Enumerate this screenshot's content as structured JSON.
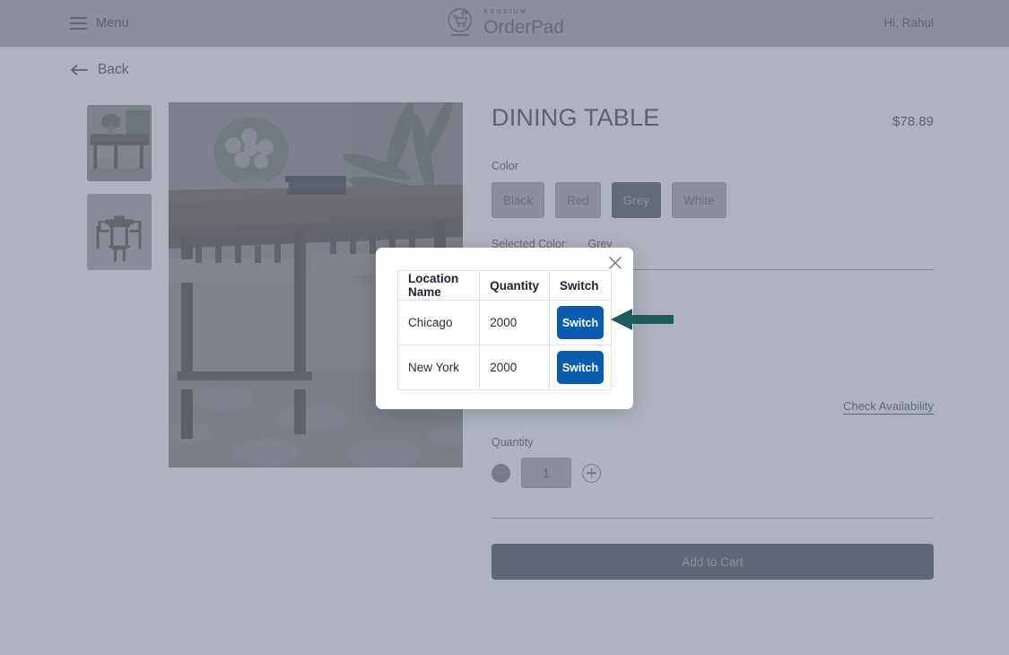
{
  "header": {
    "menu_label": "Menu",
    "brand_kicker": "KENSIUM",
    "brand_name": "OrderPad",
    "greeting": "Hi, Rahul"
  },
  "nav": {
    "back_label": "Back"
  },
  "gallery": {
    "thumbnails": [
      {
        "alt": "dining-table-with-vase",
        "selected": true
      },
      {
        "alt": "dining-table-with-chairs",
        "selected": false
      }
    ],
    "main_image_alt": "dining-table-with-vase-and-books"
  },
  "product": {
    "title": "DINING TABLE",
    "price": "$78.89",
    "color_label": "Color",
    "color_options": [
      "Black",
      "Red",
      "Grey",
      "White"
    ],
    "selected_color_index": 2,
    "selected_color_label": "Selected Color:",
    "selected_color_value": "Grey",
    "check_availability_label": "Check Availability",
    "quantity_label": "Quantity",
    "quantity_value": "1",
    "add_to_cart_label": "Add to Cart"
  },
  "modal": {
    "close_label": "×",
    "columns": [
      "Location Name",
      "Quantity",
      "Switch"
    ],
    "rows": [
      {
        "location": "Chicago",
        "quantity": "2000",
        "action": "Switch"
      },
      {
        "location": "New York",
        "quantity": "2000",
        "action": "Switch"
      }
    ]
  },
  "annotation": {
    "arrow_color": "#1f5b5e",
    "arrow_points_to": "switch-button-chicago"
  },
  "colors": {
    "switch_blue": "#0b5cad",
    "add_to_cart_blue": "#3d5b8c",
    "selected_swatch": "#5b6577",
    "overlay": "#5e687c"
  }
}
